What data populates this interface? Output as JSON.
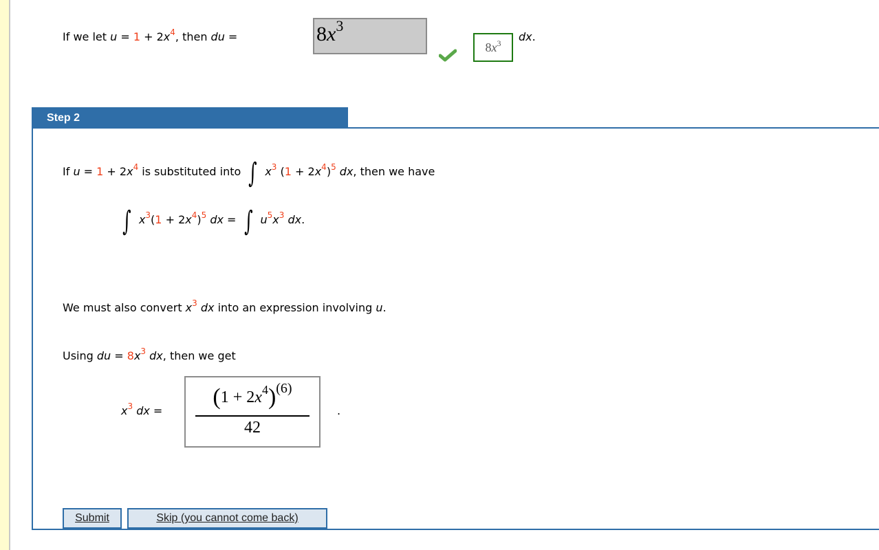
{
  "step1": {
    "prefix": "If we let ",
    "u_var": "u",
    "eq": " = ",
    "one": "1",
    "plus_2x": " + 2",
    "x": "x",
    "exp4": "4",
    "then": ",  then ",
    "du": "du",
    "eq2": " = ",
    "answer_input_value_coef": "8",
    "answer_input_value_var": "x",
    "answer_input_value_exp": "3",
    "correct_coef": "8",
    "correct_var": "x",
    "correct_exp": "3",
    "suffix_dx": "dx",
    "suffix_period": ".",
    "status_icon": "check-icon",
    "correct_color": "#1e7a12"
  },
  "step2": {
    "header": "Step 2",
    "line1": {
      "if": "If  ",
      "u": "u",
      "eq": " = ",
      "one": "1",
      "plus": " + 2",
      "x": "x",
      "exp4": "4",
      "mid": "  is substituted into ",
      "integral": "∫",
      "x2": "x",
      "exp3": "3",
      "open": " (",
      "one2": "1",
      "plus2": " + 2",
      "x3": "x",
      "exp4b": "4",
      "close": ")",
      "exp5": "5",
      "dx": " dx",
      "tail": ",  then we have"
    },
    "line2": {
      "integral": "∫",
      "x": "x",
      "exp3": "3",
      "open": "(",
      "one": "1",
      "plus": " + 2",
      "x2": "x",
      "exp4": "4",
      "close": ")",
      "exp5": "5",
      "dx": " dx",
      "eq": " = ",
      "integral2": "∫",
      "u": "u",
      "exp5b": "5",
      "x3": "x",
      "exp3b": "3",
      "dx2": " dx",
      "period": "."
    },
    "line3": {
      "pre": "We must also convert  ",
      "x": "x",
      "exp3": "3",
      "dx": " dx",
      "post": "  into an expression involving ",
      "u": "u",
      "period": "."
    },
    "line4": {
      "pre": "Using  ",
      "du": "du",
      "eq": " = ",
      "eight": "8",
      "x": "x",
      "exp3": "3",
      "dx": " dx",
      "post": ",  then we get"
    },
    "line5": {
      "x": "x",
      "exp3": "3",
      "dx": " dx",
      "eq": " = "
    },
    "answer_fraction": {
      "num_open": "(",
      "num_body": "1 + 2",
      "num_x": "x",
      "num_exp": "4",
      "num_close": ")",
      "num_power": "(6)",
      "den": "42"
    },
    "period": "."
  },
  "buttons": {
    "submit": "Submit",
    "skip": "Skip (you cannot come back)"
  },
  "colors": {
    "accent_blue": "#2f6ea8",
    "highlight_red": "#f0401b",
    "sidebar_yellow": "#fffccf"
  }
}
